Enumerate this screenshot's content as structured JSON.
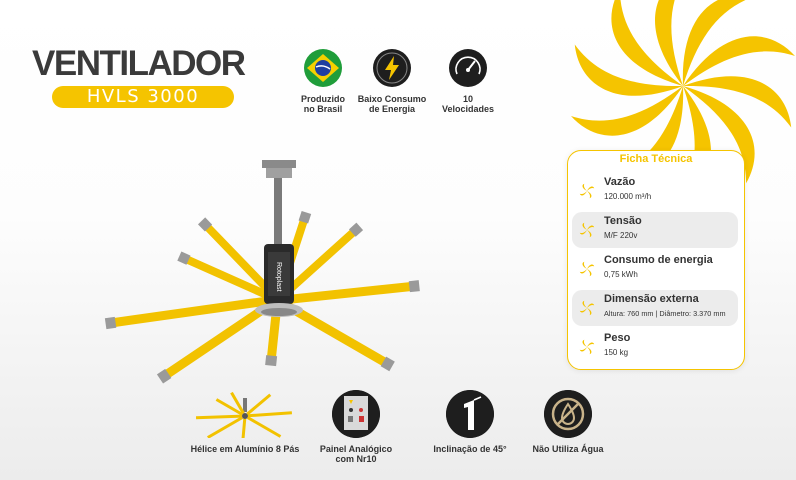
{
  "title": "VENTILADOR",
  "model": "HVLS 3000",
  "colors": {
    "yellow": "#f5c400",
    "dark": "#1e1e1e",
    "text": "#333333",
    "grey_row": "#ececec"
  },
  "badges": [
    {
      "icon": "brazil-flag-icon",
      "label": "Produzido\nno Brasil"
    },
    {
      "icon": "lightning-bolt-icon",
      "label": "Baixo Consumo\nde Energia"
    },
    {
      "icon": "speedometer-icon",
      "label": "10\nVelocidades"
    }
  ],
  "fan_brand": "Rotoplast",
  "spec_card": {
    "title": "Ficha Técnica",
    "rows": [
      {
        "icon": "fan-icon",
        "label": "Vazão",
        "value": "120.000 m³/h"
      },
      {
        "icon": "fan-icon",
        "label": "Tensão",
        "value": "M/F 220v"
      },
      {
        "icon": "fan-icon",
        "label": "Consumo de energia",
        "value": "0,75 kWh"
      },
      {
        "icon": "fan-icon",
        "label": "Dimensão externa",
        "value": "Altura: 760 mm | Diâmetro: 3.370 mm"
      },
      {
        "icon": "fan-icon",
        "label": "Peso",
        "value": "150 kg"
      }
    ]
  },
  "features": [
    {
      "icon": "propeller-8-blades-icon",
      "label": "Hélice em Alumínio 8 Pás"
    },
    {
      "icon": "control-panel-icon",
      "label": "Painel Analógico\ncom Nr10"
    },
    {
      "icon": "tilt-45-icon",
      "label": "Inclinação de 45°"
    },
    {
      "icon": "no-water-icon",
      "label": "Não Utiliza Água"
    }
  ]
}
